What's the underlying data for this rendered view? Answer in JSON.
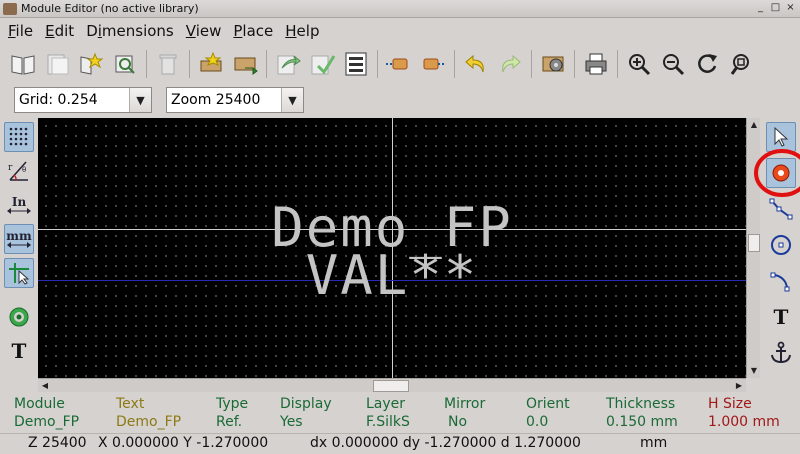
{
  "window": {
    "title": "Module Editor (no active library)",
    "min": "_",
    "max": "□",
    "close": "×"
  },
  "menus": [
    {
      "label": "File",
      "u": "F",
      "rest": "ile"
    },
    {
      "label": "Edit",
      "u": "E",
      "rest": "dit"
    },
    {
      "label": "Dimensions",
      "pre": "D",
      "u": "i",
      "rest": "mensions"
    },
    {
      "label": "View",
      "u": "V",
      "rest": "iew"
    },
    {
      "label": "Place",
      "u": "P",
      "rest": "lace"
    },
    {
      "label": "Help",
      "u": "H",
      "rest": "elp"
    }
  ],
  "aux": {
    "grid_value": "Grid: 0.254",
    "zoom_value": "Zoom 25400"
  },
  "left_toolbar": {
    "units_in": "In",
    "units_mm": "mm"
  },
  "canvas": {
    "reference_text": "Demo_FP",
    "value_text": "VAL**"
  },
  "msg_panel": {
    "module": {
      "header": "Module",
      "value": "Demo_FP"
    },
    "text": {
      "header": "Text",
      "value": "Demo_FP"
    },
    "type": {
      "header": "Type",
      "value": "Ref."
    },
    "display": {
      "header": "Display",
      "value": "Yes"
    },
    "layer": {
      "header": "Layer",
      "value": "F.SilkS"
    },
    "mirror": {
      "header": "Mirror",
      "value": "No"
    },
    "orient": {
      "header": "Orient",
      "value": "0.0"
    },
    "thickness": {
      "header": "Thickness",
      "value": "0.150 mm"
    },
    "hsize": {
      "header": "H Size",
      "value": "1.000 mm"
    }
  },
  "status": {
    "zoom": "Z 25400",
    "xy": "X 0.000000  Y -1.270000",
    "delta": "dx 0.000000  dy -1.270000  d 1.270000",
    "units": "mm"
  },
  "colors": {
    "canvas_bg": "#000000",
    "text_silk": "#c4c4c4",
    "highlight_ring": "#e01010",
    "green_label": "#1a6a36",
    "olive_label": "#8c7a14",
    "red_label": "#a01818"
  },
  "icons": {
    "toolbar": [
      "library-browse-icon",
      "save-library-icon",
      "new-module-icon",
      "load-module-icon",
      "delete-icon",
      "create-module-icon",
      "save-module-icon",
      "import-icon",
      "export-icon",
      "module-properties-icon",
      "pad-settings-left-icon",
      "pad-settings-right-icon",
      "undo-icon",
      "redo-icon",
      "settings-icon",
      "print-icon",
      "zoom-in-icon",
      "zoom-out-icon",
      "redraw-icon",
      "zoom-fit-icon"
    ],
    "right": [
      "select-arrow-icon",
      "add-pad-icon",
      "add-line-icon",
      "add-circle-icon",
      "add-arc-icon",
      "add-text-icon",
      "anchor-icon"
    ]
  }
}
